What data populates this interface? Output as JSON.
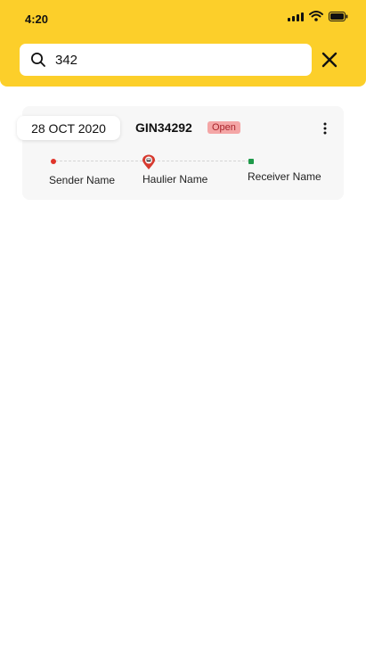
{
  "status_bar": {
    "time": "4:20",
    "icons": [
      "signal-icon",
      "wifi-icon",
      "battery-icon"
    ]
  },
  "search": {
    "value": "342",
    "icon": "search-icon",
    "close_icon": "close-icon"
  },
  "results": [
    {
      "date": "28 OCT 2020",
      "id": "GIN34292",
      "status": "Open",
      "menu_icon": "more-vertical-icon",
      "route": {
        "sender": "Sender Name",
        "haulier": "Haulier Name",
        "receiver": "Receiver Name"
      }
    }
  ],
  "colors": {
    "header": "#fccf2a",
    "status_badge_bg": "#f4a6a6",
    "status_badge_text": "#a8242b",
    "sender_dot": "#e0342a",
    "receiver_dot": "#1f9a4a",
    "haulier_pin": "#d63a2f"
  }
}
